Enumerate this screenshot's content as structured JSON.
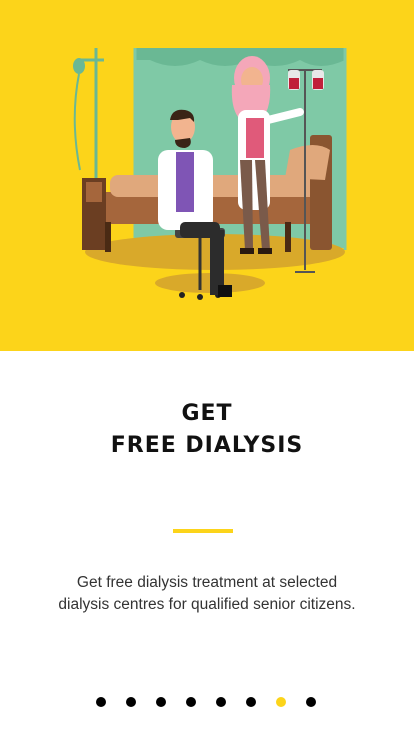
{
  "hero": {
    "illustration": "doctor-and-patient-dialysis-illustration",
    "background_color": "#fcd41a"
  },
  "title": {
    "line1": "GET",
    "line2": "FREE DIALYSIS"
  },
  "description": "Get free dialysis treatment at selected dialysis centres for qualified senior citizens.",
  "pager": {
    "count": 8,
    "active_index": 6,
    "active_color": "#fcd41a",
    "inactive_color": "#000000"
  }
}
